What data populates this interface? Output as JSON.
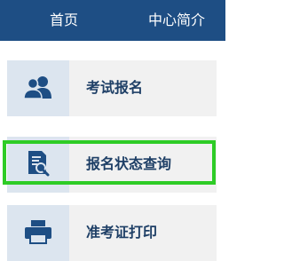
{
  "header": {
    "nav_items": [
      {
        "label": "首页"
      },
      {
        "label": "中心简介"
      }
    ]
  },
  "menu": {
    "items": [
      {
        "label": "考试报名",
        "icon": "users-icon"
      },
      {
        "label": "报名状态查询",
        "icon": "document-search-icon"
      },
      {
        "label": "准考证打印",
        "icon": "printer-icon"
      }
    ]
  },
  "colors": {
    "header_bg": "#1e4e84",
    "icon_color": "#1e4e84",
    "highlight_border": "#2ecc26",
    "menu_bg": "#f1f1f1",
    "icon_box_bg": "#dce5ef"
  }
}
